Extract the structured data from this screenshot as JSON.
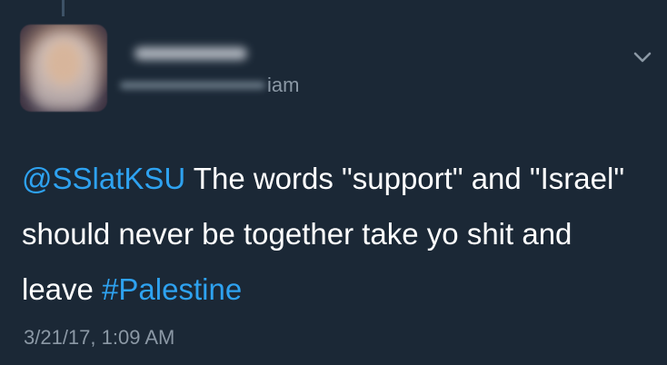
{
  "tweet": {
    "handle_suffix": "iam",
    "mention": "@SSlatKSU",
    "text_part1": " The words \"support\" and \"Israel\" should never be together take yo shit and leave ",
    "hashtag": "#Palestine",
    "timestamp": "3/21/17, 1:09 AM"
  },
  "icons": {
    "menu": "chevron-down-icon"
  },
  "colors": {
    "background": "#1b2836",
    "link": "#2ea2f0",
    "text": "#ffffff",
    "secondary": "#8b98a5"
  }
}
